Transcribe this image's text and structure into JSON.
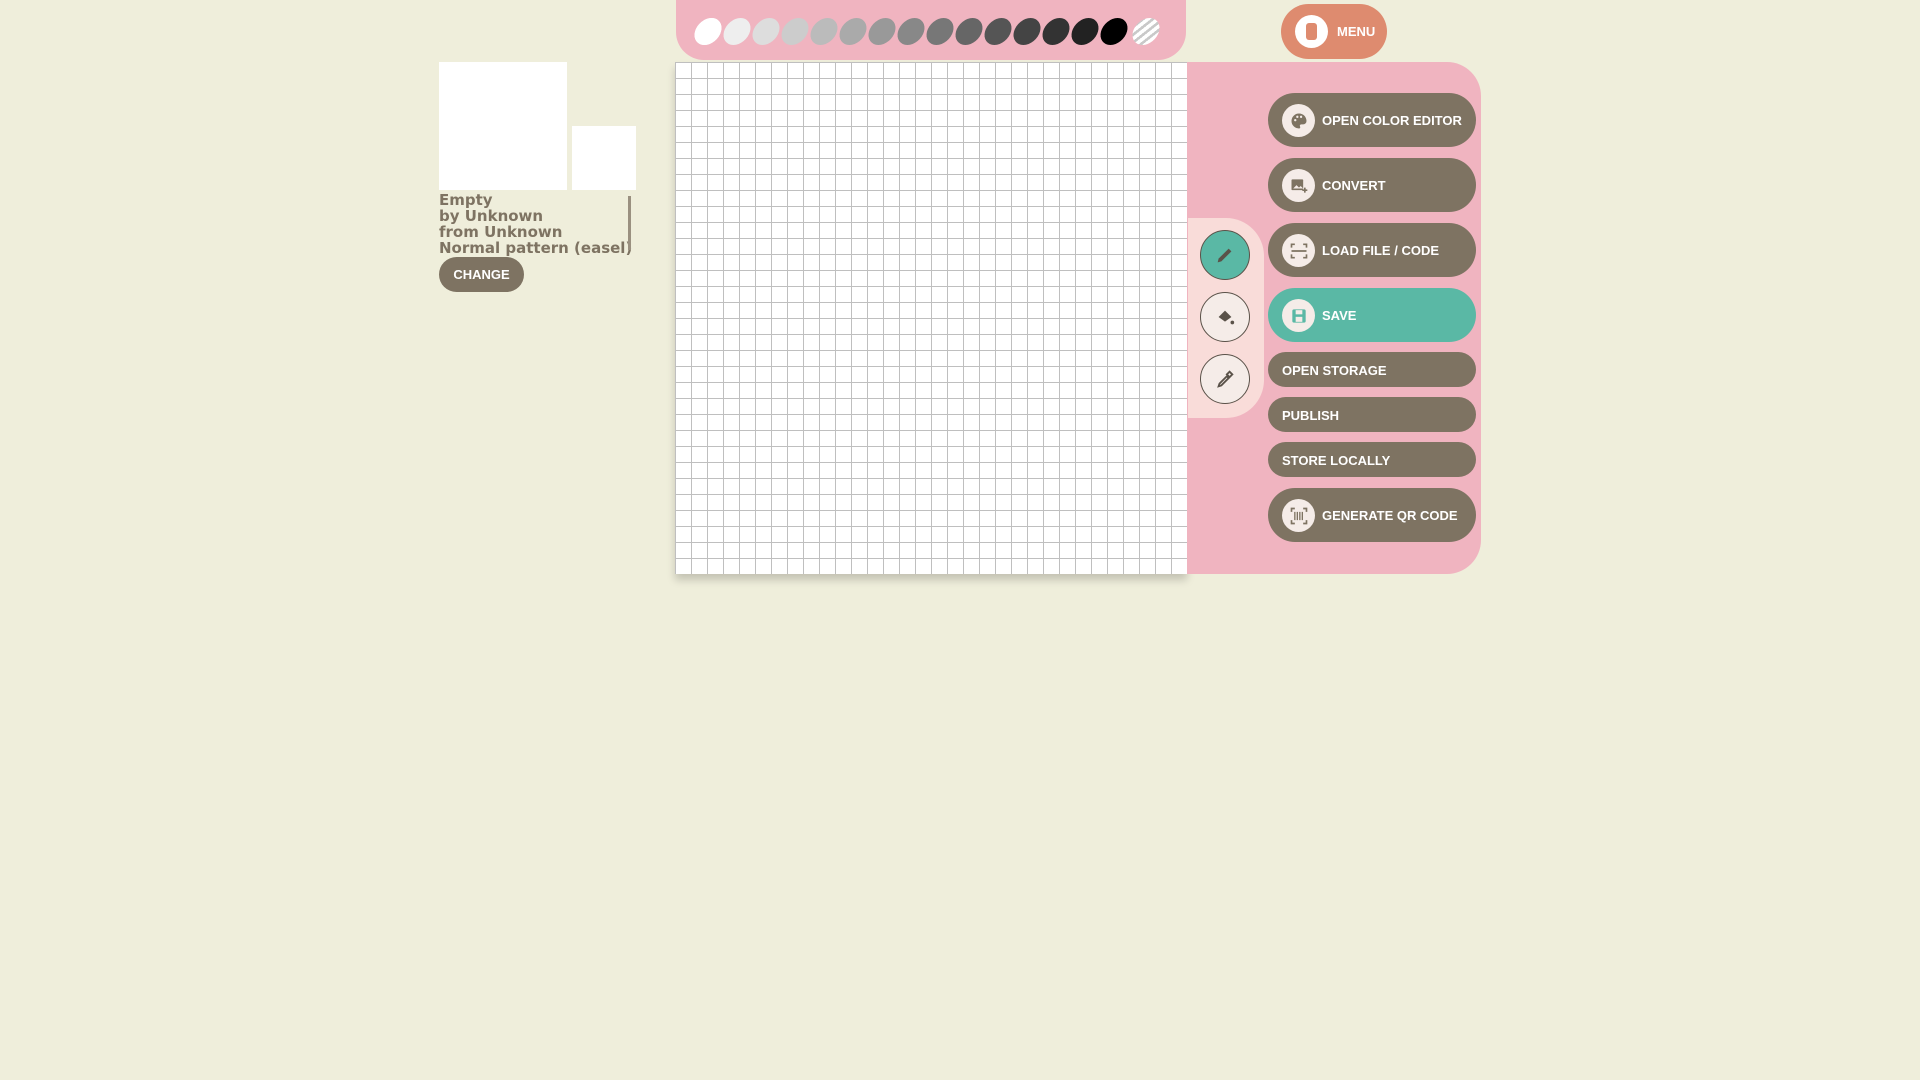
{
  "pattern_info": {
    "name": "Empty",
    "author": "by Unknown",
    "town": "from Unknown",
    "type": "Normal pattern (easel)",
    "change_label": "CHANGE"
  },
  "menu": {
    "label": "MENU",
    "icon": "phone-icon"
  },
  "palette": {
    "colors": [
      "#ffffff",
      "#eeeeee",
      "#dddddd",
      "#cccccc",
      "#bbbbbb",
      "#aaaaaa",
      "#999999",
      "#888888",
      "#777777",
      "#666666",
      "#555555",
      "#444444",
      "#333333",
      "#222222",
      "#000000"
    ],
    "transparent_swatch": true,
    "selected_index": 0
  },
  "canvas": {
    "grid_cells": 32
  },
  "tools": [
    {
      "name": "pencil-icon",
      "active": true
    },
    {
      "name": "paint-bucket-icon",
      "active": false
    },
    {
      "name": "eyedropper-icon",
      "active": false
    }
  ],
  "actions": {
    "open_color_editor": "OPEN COLOR EDITOR",
    "convert": "CONVERT",
    "load_file": "LOAD FILE / CODE",
    "save": "SAVE",
    "open_storage": "OPEN STORAGE",
    "publish": "PUBLISH",
    "store_locally": "STORE LOCALLY",
    "generate_qr": "GENERATE QR CODE"
  },
  "colors": {
    "background": "#efeedb",
    "panel_pink": "#f0b4c0",
    "button_brown": "#7e7362",
    "accent_teal": "#5ab8a5",
    "menu_orange": "#de8b6f"
  }
}
